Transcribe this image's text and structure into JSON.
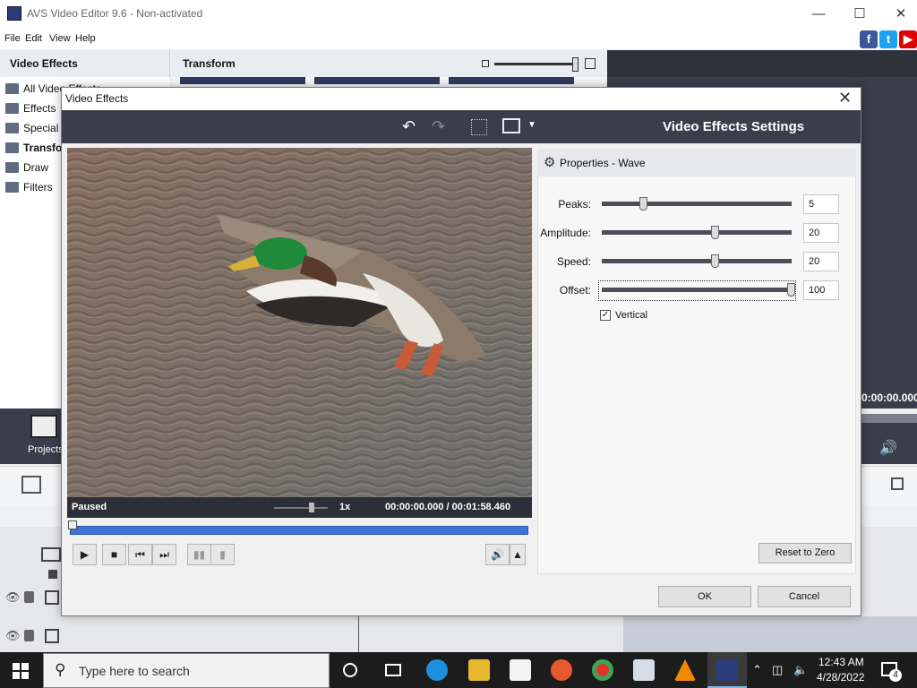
{
  "window": {
    "title": "AVS Video Editor 9.6 - Non-activated"
  },
  "menu": [
    "File",
    "Edit",
    "View",
    "Help"
  ],
  "left_panel": {
    "header": "Video Effects",
    "items": [
      {
        "label": "All Video Effects"
      },
      {
        "label": "Effects"
      },
      {
        "label": "Special"
      },
      {
        "label": "Transform"
      },
      {
        "label": "Draw"
      },
      {
        "label": "Filters"
      }
    ]
  },
  "transform_panel": {
    "header": "Transform"
  },
  "right_panel": {
    "time": "0:00:00.000"
  },
  "bottom_nav": {
    "projects_label": "Projects"
  },
  "dialog": {
    "title": "Video Effects",
    "heading": "Video Effects Settings",
    "player": {
      "status": "Paused",
      "speed": "1x",
      "current_time": "00:00:00.000",
      "separator": "/",
      "total_time": "00:01:58.460"
    },
    "properties": {
      "title": "Properties - Wave",
      "params": [
        {
          "label": "Peaks:",
          "value": "5",
          "level": 0.22
        },
        {
          "label": "Amplitude:",
          "value": "20",
          "level": 0.6
        },
        {
          "label": "Speed:",
          "value": "20",
          "level": 0.6
        },
        {
          "label": "Offset:",
          "value": "100",
          "level": 1.0
        }
      ],
      "vertical_label": "Vertical",
      "vertical_checked": true
    },
    "reset_label": "Reset to Zero",
    "ok_label": "OK",
    "cancel_label": "Cancel"
  },
  "taskbar": {
    "search_placeholder": "Type here to search",
    "time": "12:43 AM",
    "date": "4/28/2022",
    "notification_count": "4"
  },
  "colors": {
    "dark_panel": "#3a3e4a",
    "progress": "#3f72d8",
    "facebook": "#3b5998",
    "twitter": "#1da1f2",
    "youtube": "#e00000"
  }
}
